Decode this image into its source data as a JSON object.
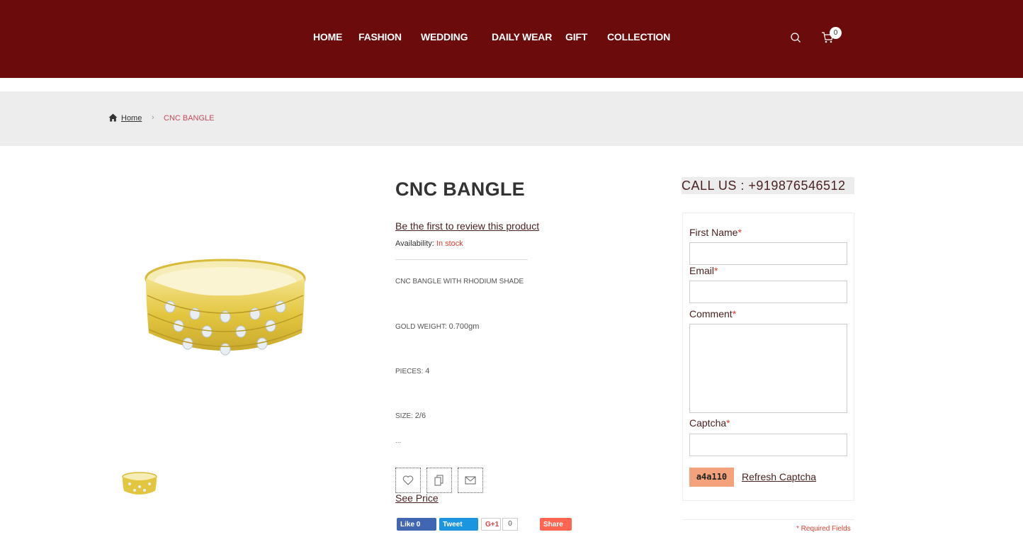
{
  "nav": {
    "items": [
      "HOME",
      "FASHION",
      "WEDDING",
      "DAILY WEAR",
      "GIFT",
      "COLLECTION"
    ]
  },
  "header": {
    "cart_count": "0",
    "icons": [
      "search-icon",
      "cart-icon"
    ]
  },
  "breadcrumb": {
    "home": "Home",
    "separator": "›",
    "current": "CNC BANGLE"
  },
  "product": {
    "title": "CNC BANGLE",
    "review_text": "Be the first to review this product",
    "availability_label": "Availability:",
    "availability_value": "In stock",
    "description": [
      {
        "label": "CNC BANGLE WITH RHODIUM SHADE",
        "value": ""
      },
      {
        "label": "GOLD WEIGHT:",
        "value": "0.700gm"
      },
      {
        "label": "PIECES:",
        "value": "4"
      },
      {
        "label": "SIZE:",
        "value": "2/6"
      }
    ],
    "ellipsis": "...",
    "see_price": "See Price",
    "action_icons": [
      "heart-icon",
      "compare-icon",
      "mail-icon"
    ]
  },
  "social": {
    "like": "Like 0",
    "tweet": "Tweet",
    "gplus": "G+1",
    "gplus_count": "0",
    "share": "Share"
  },
  "sidebar": {
    "call_us": "CALL US : +919876546512",
    "form": {
      "first_name_label": "First Name",
      "email_label": "Email",
      "comment_label": "Comment",
      "captcha_label": "Captcha",
      "required_mark": "*",
      "captcha_text": "a4a110",
      "refresh_label": "Refresh Captcha",
      "required_note": "* Required Fields"
    }
  },
  "colors": {
    "header_bg": "#6b0b0b",
    "accent_red": "#e0412e",
    "breadcrumb_bg": "#ededed",
    "gold": "#e8c84a"
  }
}
